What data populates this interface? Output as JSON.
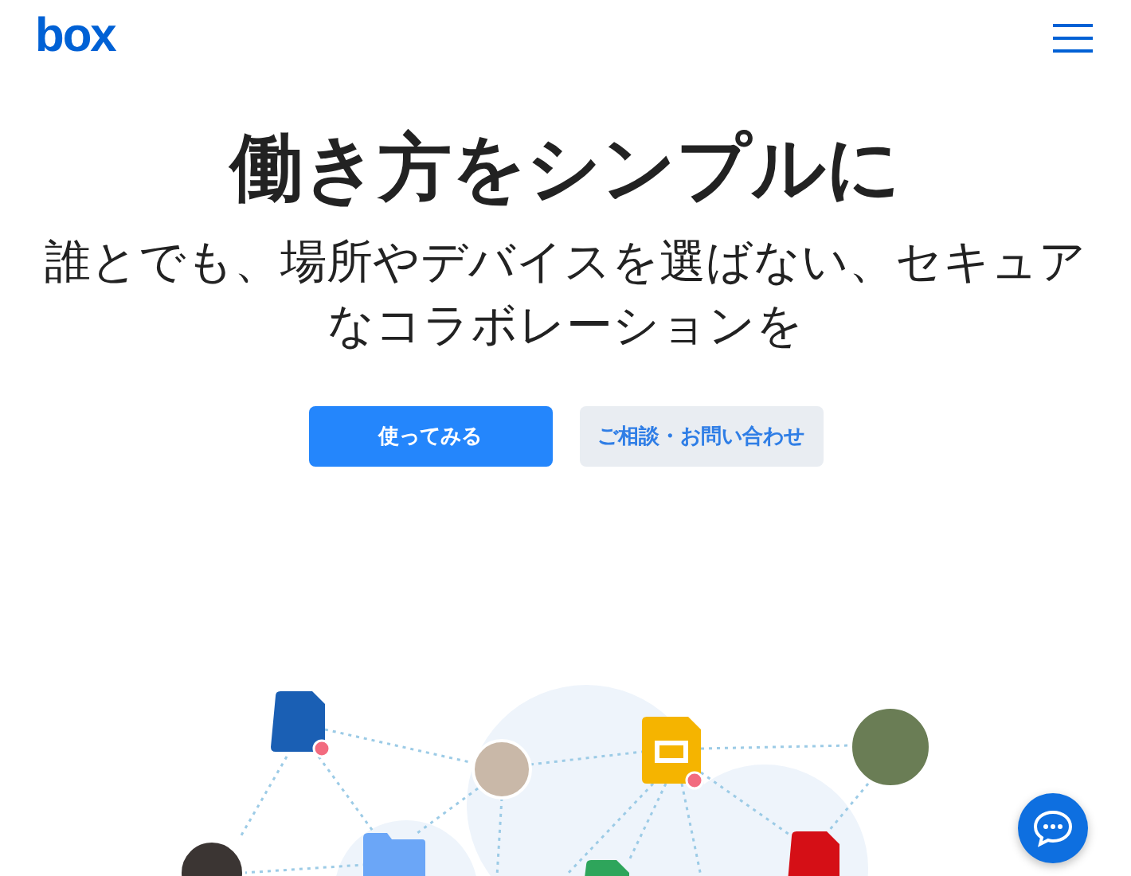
{
  "header": {
    "logo": "box"
  },
  "hero": {
    "title": "働き方をシンプルに",
    "subtitle": "誰とでも、場所やデバイスを選ばない、セキュアなコラボレーションを"
  },
  "buttons": [
    {
      "label": "使ってみる",
      "kind": "primary"
    },
    {
      "label": "ご相談・お問い合わせ",
      "kind": "secondary"
    }
  ]
}
